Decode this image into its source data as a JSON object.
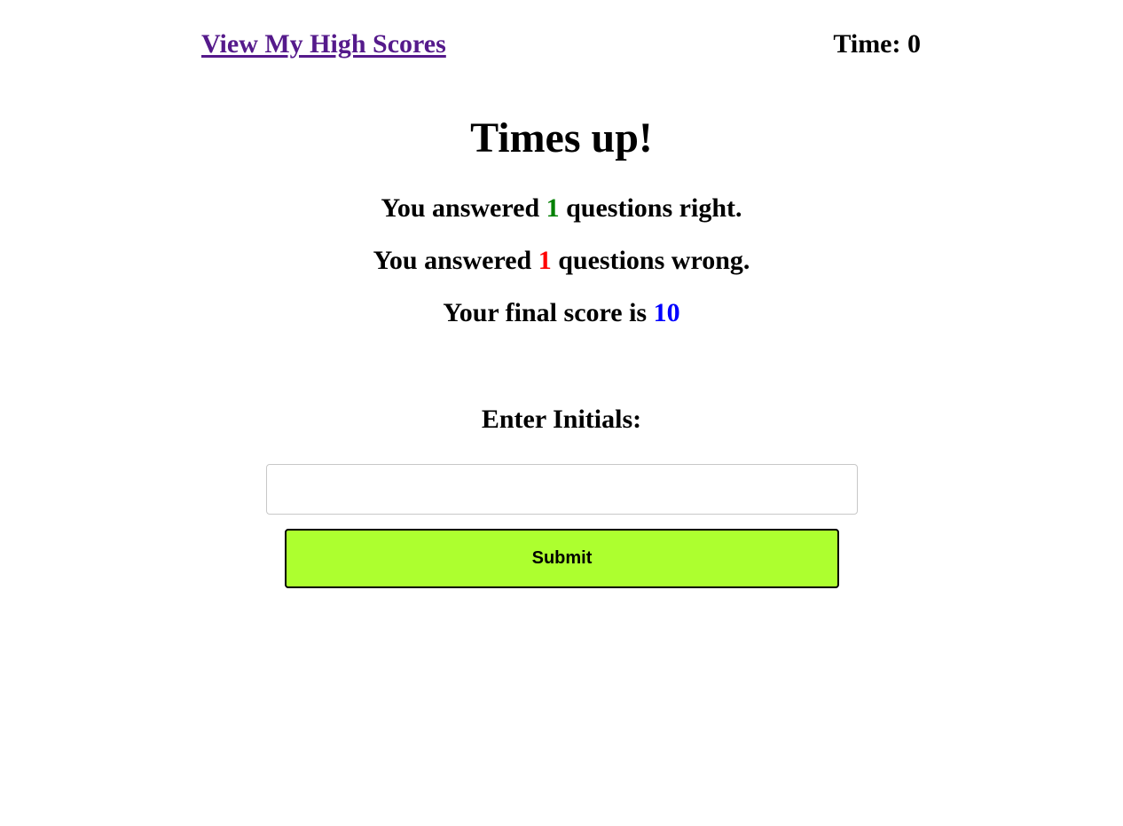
{
  "header": {
    "high_scores_link": "View My High Scores",
    "timer_label": "Time: ",
    "timer_value": "0"
  },
  "results": {
    "title": "Times up!",
    "right_prefix": "You answered ",
    "right_count": "1",
    "right_suffix": " questions right.",
    "wrong_prefix": "You answered ",
    "wrong_count": "1",
    "wrong_suffix": " questions wrong.",
    "score_prefix": "Your final score is ",
    "score_value": "10"
  },
  "form": {
    "initials_label": "Enter Initials:",
    "initials_value": "",
    "submit_label": "Submit"
  },
  "colors": {
    "link": "#551a8b",
    "right_count": "#008000",
    "wrong_count": "#ff0000",
    "score_value": "#0000ff",
    "submit_background": "#adff2f"
  }
}
